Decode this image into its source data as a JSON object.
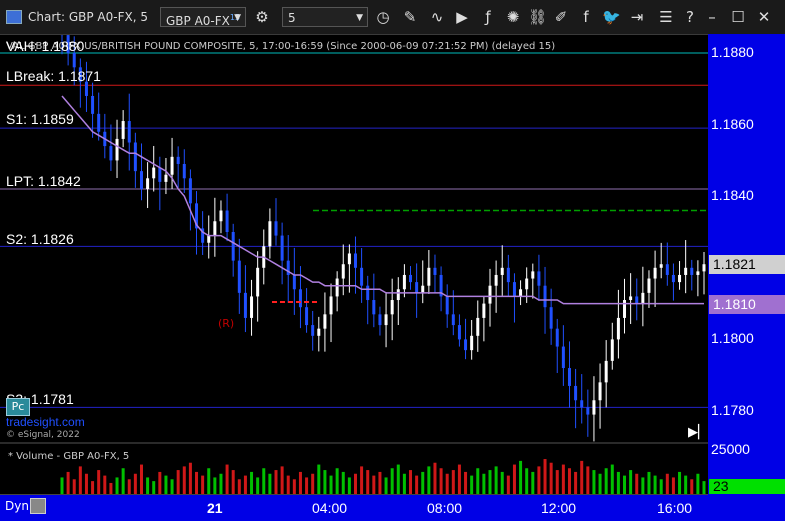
{
  "window": {
    "title": "Chart: GBP A0-FX, 5",
    "symbol_value": "GBP A0-FX",
    "symbol_superscript": "15",
    "interval_value": "5"
  },
  "chart_header": {
    "line1": "VAL GBP A0-FX US/BRITISH POUND COMPOSITE, 5, 17:00-16:59 (Since 2000-06-09 07:21:52 PM) (delayed 15)"
  },
  "levels": [
    {
      "label": "VAH: 1.1880",
      "price": 1.188,
      "color": "#00bcbc"
    },
    {
      "label": "LBreak: 1.1871",
      "price": 1.1871,
      "color": "#d01818"
    },
    {
      "label": "S1: 1.1859",
      "price": 1.1859,
      "color": "#2323c8"
    },
    {
      "label": "LPT: 1.1842",
      "price": 1.1842,
      "color": "#9070b0"
    },
    {
      "label": "S2: 1.1826",
      "price": 1.1826,
      "color": "#2323c8"
    },
    {
      "label": "S3: 1.1781",
      "price": 1.1781,
      "color": "#2323c8"
    }
  ],
  "badges": {
    "pc": "Pc",
    "r_marker": "(R)",
    "dyn": "Dyn",
    "arrows": "▶▏"
  },
  "price_axis": {
    "ticks": [
      "1.1880",
      "1.1860",
      "1.1840",
      "1.1800",
      "1.1780"
    ],
    "tick_values": [
      1.188,
      1.186,
      1.184,
      1.18,
      1.178
    ],
    "current_price": "1.1821",
    "ma_price": "1.1810"
  },
  "volume": {
    "label": "* Volume - GBP A0-FX, 5",
    "axis_top": "25000",
    "current": "23"
  },
  "watermark": {
    "brand": "tradesight.com",
    "copyright": "© eSignal, 2022"
  },
  "chart_data": {
    "type": "candlestick",
    "ylim": [
      1.1772,
      1.1888
    ],
    "x_ticks": [
      "21",
      "04:00",
      "08:00",
      "12:00",
      "16:00"
    ],
    "moving_average_color": "#b080e0",
    "up_color": "#ffffff",
    "down_color": "#2050ff",
    "closes": [
      1.1885,
      1.188,
      1.1876,
      1.1872,
      1.1868,
      1.1863,
      1.1858,
      1.1854,
      1.185,
      1.1856,
      1.1861,
      1.1855,
      1.1847,
      1.1842,
      1.1845,
      1.1848,
      1.1844,
      1.1846,
      1.1851,
      1.1849,
      1.1845,
      1.1838,
      1.1831,
      1.1827,
      1.1829,
      1.1833,
      1.1836,
      1.183,
      1.1822,
      1.1813,
      1.1806,
      1.1812,
      1.182,
      1.1826,
      1.1833,
      1.1829,
      1.1822,
      1.1818,
      1.1814,
      1.1809,
      1.1804,
      1.1801,
      1.1803,
      1.1807,
      1.1812,
      1.1817,
      1.1821,
      1.1824,
      1.182,
      1.1815,
      1.1811,
      1.1807,
      1.1804,
      1.1807,
      1.1811,
      1.1814,
      1.1818,
      1.1816,
      1.1813,
      1.1815,
      1.182,
      1.1818,
      1.1812,
      1.1807,
      1.1804,
      1.18,
      1.1797,
      1.1801,
      1.1806,
      1.181,
      1.1815,
      1.1818,
      1.182,
      1.1816,
      1.1812,
      1.1814,
      1.1817,
      1.1819,
      1.1815,
      1.1809,
      1.1803,
      1.1798,
      1.1792,
      1.1787,
      1.1783,
      1.1781,
      1.1779,
      1.1783,
      1.1788,
      1.1794,
      1.18,
      1.1806,
      1.1811,
      1.1812,
      1.181,
      1.1813,
      1.1817,
      1.182,
      1.1821,
      1.1818,
      1.1816,
      1.1818,
      1.182,
      1.1818,
      1.1819,
      1.1821
    ],
    "moving_average": [
      1.1868,
      1.1866,
      1.1864,
      1.1862,
      1.186,
      1.1858,
      1.1857,
      1.1856,
      1.1855,
      1.1854,
      1.1853,
      1.1852,
      1.1852,
      1.1851,
      1.185,
      1.1849,
      1.1848,
      1.1847,
      1.1845,
      1.1842,
      1.184,
      1.1836,
      1.1832,
      1.183,
      1.1829,
      1.1829,
      1.1829,
      1.1828,
      1.1827,
      1.1826,
      1.1825,
      1.1824,
      1.1823,
      1.1823,
      1.1822,
      1.1821,
      1.182,
      1.1819,
      1.1818,
      1.1818,
      1.1817,
      1.1816,
      1.1816,
      1.1815,
      1.1815,
      1.1815,
      1.1815,
      1.1815,
      1.1815,
      1.1814,
      1.1814,
      1.1814,
      1.1814,
      1.1813,
      1.1813,
      1.1813,
      1.1813,
      1.1813,
      1.1813,
      1.1813,
      1.1813,
      1.1813,
      1.1813,
      1.1812,
      1.1812,
      1.1812,
      1.1812,
      1.1812,
      1.1812,
      1.1812,
      1.1812,
      1.1812,
      1.1812,
      1.1812,
      1.1812,
      1.1812,
      1.1812,
      1.1812,
      1.1811,
      1.1811,
      1.1811,
      1.1811,
      1.181,
      1.181,
      1.181,
      1.181,
      1.181,
      1.181,
      1.181,
      1.181,
      1.181,
      1.181,
      1.181,
      1.181,
      1.181,
      1.181,
      1.181,
      1.181,
      1.181,
      1.181,
      1.181,
      1.181,
      1.181,
      1.181,
      1.181,
      1.181
    ],
    "green_dashed_level": 1.1836,
    "red_dashed_level": 1.181,
    "volume_values": [
      9000,
      12000,
      8000,
      15000,
      11000,
      7000,
      13000,
      10000,
      6000,
      9000,
      14000,
      8000,
      11000,
      16000,
      9000,
      7000,
      12000,
      10000,
      8000,
      13000,
      15000,
      17000,
      12000,
      10000,
      14000,
      9000,
      11000,
      16000,
      13000,
      8000,
      10000,
      12000,
      9000,
      14000,
      11000,
      13000,
      15000,
      10000,
      8000,
      12000,
      9000,
      11000,
      16000,
      13000,
      10000,
      14000,
      12000,
      9000,
      11000,
      15000,
      13000,
      10000,
      12000,
      9000,
      14000,
      16000,
      11000,
      13000,
      10000,
      12000,
      15000,
      17000,
      14000,
      11000,
      13000,
      16000,
      12000,
      10000,
      14000,
      11000,
      13000,
      15000,
      12000,
      10000,
      16000,
      18000,
      14000,
      12000,
      15000,
      19000,
      17000,
      13000,
      16000,
      14000,
      12000,
      18000,
      15000,
      13000,
      11000,
      14000,
      16000,
      12000,
      10000,
      13000,
      11000,
      9000,
      12000,
      10000,
      8000,
      11000,
      9000,
      12000,
      10000,
      8000,
      11000,
      7000
    ]
  }
}
